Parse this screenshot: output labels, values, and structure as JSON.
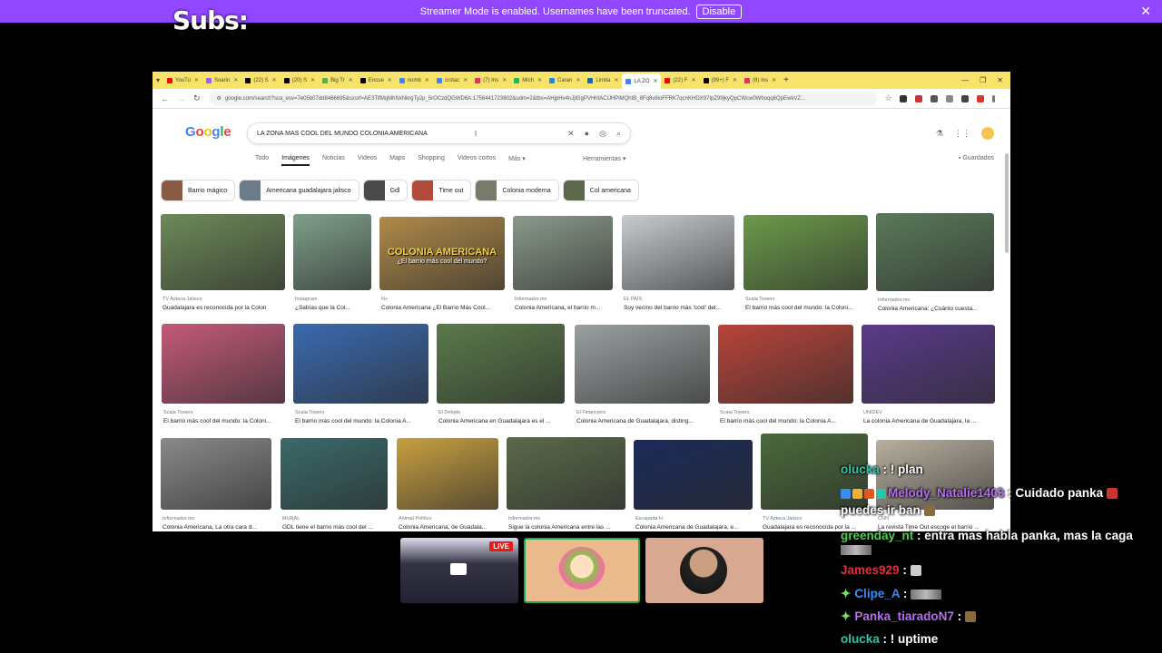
{
  "banner": {
    "text": "Streamer Mode is enabled. Usernames have been truncated.",
    "disable_label": "Disable",
    "close_icon": "close-icon",
    "color": "#9147ff"
  },
  "overlay": {
    "subs_label": "Subs:"
  },
  "browser": {
    "tabs": [
      {
        "label": "YouTu",
        "color": "#ff0000"
      },
      {
        "label": "Soarin",
        "color": "#a259ff"
      },
      {
        "label": "(22) S",
        "color": "#000000"
      },
      {
        "label": "(20) S",
        "color": "#000000"
      },
      {
        "label": "Big Tr",
        "color": "#4caf50"
      },
      {
        "label": "Encue",
        "color": "#000000"
      },
      {
        "label": "nomb",
        "color": "#4285f4"
      },
      {
        "label": "crotac",
        "color": "#4285f4"
      },
      {
        "label": "(7) Ins",
        "color": "#e1306c"
      },
      {
        "label": "Mich",
        "color": "#1db954"
      },
      {
        "label": "Caran",
        "color": "#1e88e5"
      },
      {
        "label": "Limita",
        "color": "#1565c0"
      },
      {
        "label": "LA ZO",
        "color": "#4285f4",
        "active": true
      },
      {
        "label": "(22) F",
        "color": "#ff0000"
      },
      {
        "label": "(99+) F",
        "color": "#000000"
      },
      {
        "label": "(8) Ins",
        "color": "#e1306c"
      }
    ],
    "url": "google.com/search?sca_esv=7e05b07dd8466695&sxsrf=AE3TifMqMhNxNkrgTy2p_5rOCzdQGWD6A:1756441723802&udm=2&tbs=AHjpHv4nJjlGgPVHhfAClJHPiMQhtB_8Fq8v8ioFFRK7qcnKHDX97IpZ99jkyQpCWcw0Whoqq6QpEwkVZ...",
    "search_query": "LA ZONA MAS COOL DEL MUNDO COLONIA AMERICANA",
    "nav_tabs": [
      "Todo",
      "Imágenes",
      "Noticias",
      "Videos",
      "Maps",
      "Shopping",
      "Videos cortos",
      "Más ▾"
    ],
    "tools_label": "Herramientas ▾",
    "saved_label": "Guardados",
    "chips": [
      {
        "label": "Barrio mágico",
        "color": "#8a5a44"
      },
      {
        "label": "Americana guadalajara jalisco",
        "color": "#6b7b8a"
      },
      {
        "label": "Gdl",
        "color": "#4a4a4a"
      },
      {
        "label": "Time out",
        "color": "#b04a3a"
      },
      {
        "label": "Colonia moderna",
        "color": "#7a7a6a"
      },
      {
        "label": "Col americana",
        "color": "#5a6a4a"
      }
    ],
    "results": [
      {
        "source": "TV Azteca Jalisco",
        "caption": "Guadalajara es reconocida por la Colon",
        "color": "#6d8a58"
      },
      {
        "source": "Instagram",
        "caption": "¿Sabías que la Col...",
        "color": "#7fa08a"
      },
      {
        "source": "N+",
        "caption": "Colonia Americana ¿El Barrio Más Cool...",
        "color": "#b08a4a",
        "overlay": "COLONIA AMERICANA",
        "overlay_sub": "¿El barrio más cool del mundo?"
      },
      {
        "source": "Informador.mx",
        "caption": "Colonia Americana, el barrio m...",
        "color": "#8a9a8a"
      },
      {
        "source": "EL PAÍS",
        "caption": "Soy vecino del barrio más 'cool' del...",
        "color": "#c8ccd0"
      },
      {
        "source": "Scala Towers",
        "caption": "El barrio más cool del mundo: la Coloni...",
        "color": "#6c9a4a"
      },
      {
        "source": "Informador.mx",
        "caption": "Colonia Americana: ¿Cuánto cuesta...",
        "color": "#5a7a5a"
      },
      {
        "source": "Scala Towers",
        "caption": "El barrio más cool del mundo: la Coloni...",
        "color": "#c45a7a"
      },
      {
        "source": "Scala Towers",
        "caption": "El barrio más cool del mundo: la Colonia A...",
        "color": "#3a6ab0"
      },
      {
        "source": "El Debate",
        "caption": "Colonia Americana en Guadalajara es el ...",
        "color": "#5a7a4a"
      },
      {
        "source": "El Financiero",
        "caption": "Colonia Americana de Guadalajara, disting...",
        "color": "#9aa0a0"
      },
      {
        "source": "Scala Towers",
        "caption": "El barrio más cool del mundo: la Colonia A...",
        "color": "#b8443a"
      },
      {
        "source": "UNIDEV",
        "caption": "La colonia Americana de Guadalajara, la ...",
        "color": "#5a3a8a"
      },
      {
        "source": "Informador.mx",
        "caption": "Colonia Americana, La otra cara d...",
        "color": "#8a8a8a"
      },
      {
        "source": "MURAL",
        "caption": "GDL tiene el barrio más cool del ...",
        "color": "#3a6a6a"
      },
      {
        "source": "Animal Político",
        "caption": "Colonia Americana, de Guadala...",
        "color": "#c8a040"
      },
      {
        "source": "Informador.mx",
        "caption": "Sigue la colonia Americana entre las ...",
        "color": "#5a6a4a"
      },
      {
        "source": "Escapada H",
        "caption": "Colonia Americana de Guadalajara, e...",
        "color": "#1a2a5a"
      },
      {
        "source": "TV Azteca Jalisco",
        "caption": "Guadalajara es reconocida por la ...",
        "color": "#4a6a3a"
      },
      {
        "source": "CNN",
        "caption": "La revista Time Out escoge el barrio ...",
        "color": "#b8b0a0"
      }
    ]
  },
  "chat": [
    {
      "user": "olucka",
      "user_color": "#2ec4a8",
      "text": ": ! plan"
    },
    {
      "user": "Melody_Natalie1403",
      "user_color": "#b86cf0",
      "text": ": Cuidado panka",
      "extra": "puedes ir ban"
    },
    {
      "user": "greenday_nt",
      "user_color": "#4cd04c",
      "text": ": entra mas habla panka, mas la caga"
    },
    {
      "user": "James929",
      "user_color": "#e0303c",
      "text": ":"
    },
    {
      "user": "Clipe_A",
      "user_color": "#3a8cf0",
      "text": ":"
    },
    {
      "user": "Panka_tiaradoN7",
      "user_color": "#b86cf0",
      "text": ":"
    },
    {
      "user": "olucka",
      "user_color": "#2ec4a8",
      "text": ": ! uptime"
    }
  ],
  "cams": {
    "live_label": "LIVE"
  }
}
